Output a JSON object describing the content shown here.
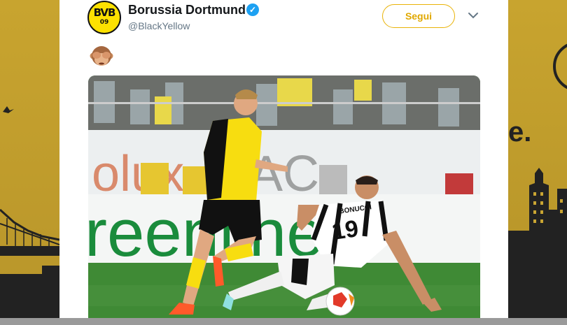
{
  "tweet": {
    "account_name": "Borussia Dortmund",
    "handle": "@BlackYellow",
    "follow_label": "Segui",
    "avatar_text": "BVB",
    "avatar_year": "09",
    "verified_mark": "✓",
    "emoji_name": "see-no-evil-monkey-icon"
  },
  "photo": {
    "player_name_on_shirt": "BONUCCI",
    "player_number": "19"
  },
  "colors": {
    "bvb_yellow": "#fde100",
    "follow_accent": "#e9b307",
    "verified_blue": "#1da1f2",
    "background_gold": "#c9a532"
  }
}
